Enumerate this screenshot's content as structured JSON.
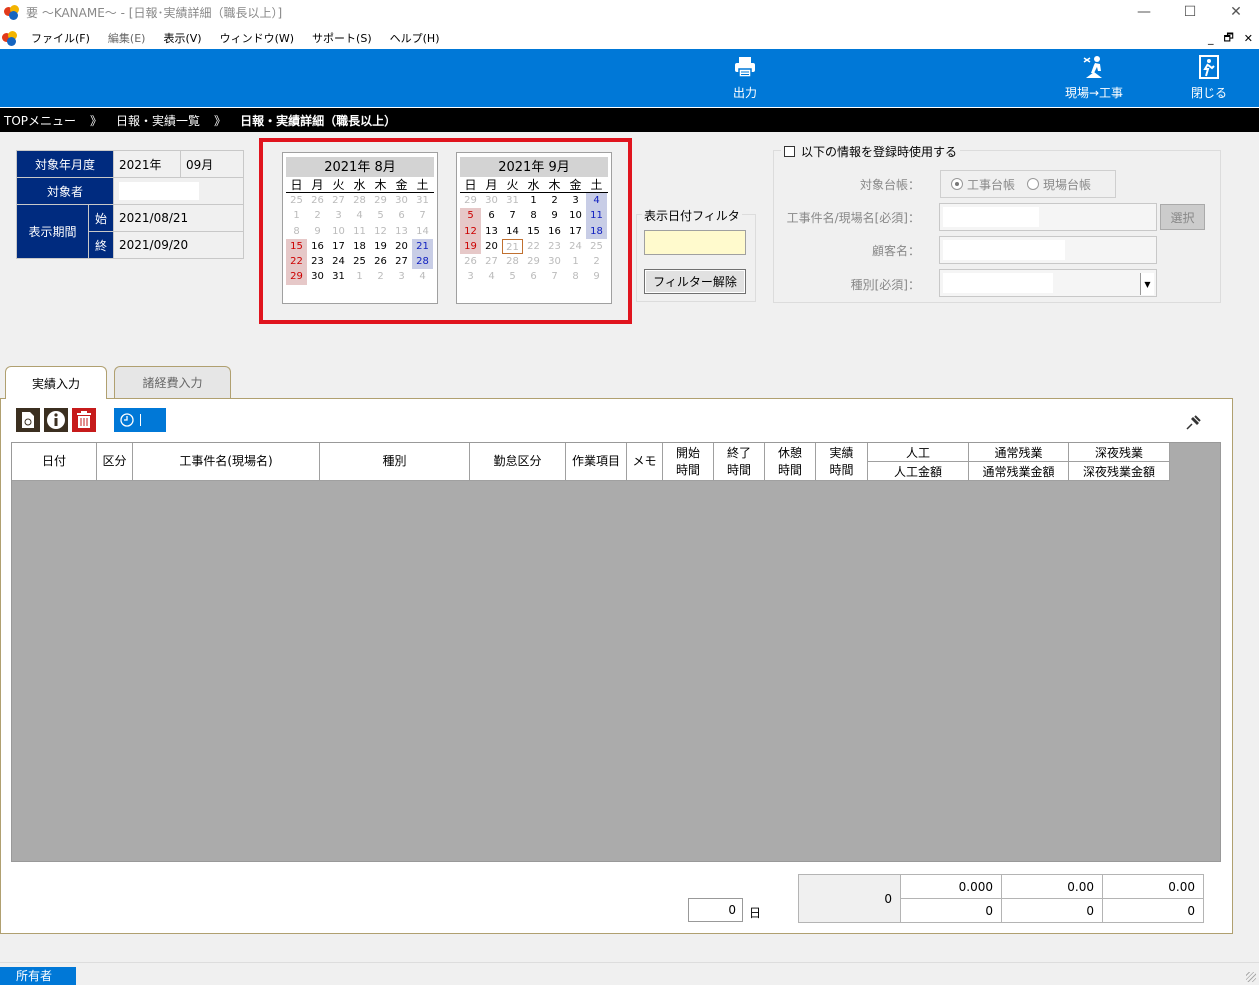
{
  "window": {
    "title": "要 〜KANAME〜 - [日報･実績詳細（職長以上）]",
    "minimize": "—",
    "maximize": "☐",
    "close": "✕"
  },
  "menu": {
    "items": [
      "ファイル(F)",
      "編集(E)",
      "表示(V)",
      "ウィンドウ(W)",
      "サポート(S)",
      "ヘルプ(H)"
    ],
    "mdi_minimize": "_",
    "mdi_restore": "🗗",
    "mdi_close": "✕"
  },
  "toolbar": {
    "print_label": "出力",
    "site_work_label": "現場→工事",
    "close_label": "閉じる"
  },
  "breadcrumb": {
    "items": [
      "TOPメニュー",
      "日報・実績一覧",
      "日報・実績詳細（職長以上）"
    ],
    "separator": "》"
  },
  "info": {
    "year_month_label": "対象年月度",
    "year_value": "2021年",
    "month_value": "09月",
    "person_label": "対象者",
    "period_label": "表示期間",
    "start_label": "始",
    "start_value": "2021/08/21",
    "end_label": "終",
    "end_value": "2021/09/20"
  },
  "calendars": [
    {
      "year": "2021年",
      "month": "8月",
      "weekdays": [
        "日",
        "月",
        "火",
        "水",
        "木",
        "金",
        "土"
      ],
      "days": [
        "25",
        "26",
        "27",
        "28",
        "29",
        "30",
        "31",
        "1",
        "2",
        "3",
        "4",
        "5",
        "6",
        "7",
        "8",
        "9",
        "10",
        "11",
        "12",
        "13",
        "14",
        "15",
        "16",
        "17",
        "18",
        "19",
        "20",
        "21",
        "22",
        "23",
        "24",
        "25",
        "26",
        "27",
        "28",
        "29",
        "30",
        "31",
        "1",
        "2",
        "3",
        "4"
      ]
    },
    {
      "year": "2021年",
      "month": "9月",
      "weekdays": [
        "日",
        "月",
        "火",
        "水",
        "木",
        "金",
        "土"
      ],
      "days": [
        "29",
        "30",
        "31",
        "1",
        "2",
        "3",
        "4",
        "5",
        "6",
        "7",
        "8",
        "9",
        "10",
        "11",
        "12",
        "13",
        "14",
        "15",
        "16",
        "17",
        "18",
        "19",
        "20",
        "21",
        "22",
        "23",
        "24",
        "25",
        "26",
        "27",
        "28",
        "29",
        "30",
        "1",
        "2",
        "3",
        "4",
        "5",
        "6",
        "7",
        "8",
        "9"
      ]
    }
  ],
  "filter": {
    "title": "表示日付フィルタ",
    "value": "",
    "clear_label": "フィルター解除"
  },
  "register": {
    "checkbox_label": "以下の情報を登録時使用する",
    "ledger_label": "対象台帳：",
    "radio_construction": "工事台帳",
    "radio_site": "現場台帳",
    "work_name_label": "工事件名/現場名[必須]：",
    "select_label": "選択",
    "customer_label": "顧客名：",
    "type_label": "種別[必須]："
  },
  "tabs": {
    "actual": "実績入力",
    "expenses": "諸経費入力"
  },
  "grid": {
    "columns": [
      "日付",
      "区分",
      "工事件名(現場名)",
      "種別",
      "勤怠区分",
      "作業項目",
      "メモ"
    ],
    "time_cols": [
      [
        "開始",
        "時間"
      ],
      [
        "終了",
        "時間"
      ],
      [
        "休憩",
        "時間"
      ],
      [
        "実績",
        "時間"
      ]
    ],
    "split_cols": [
      [
        "人工",
        "人工金額"
      ],
      [
        "通常残業",
        "通常残業金額"
      ],
      [
        "深夜残業",
        "深夜残業金額"
      ]
    ]
  },
  "summary": {
    "days_value": "0",
    "days_unit": "日",
    "total": "0",
    "row1": [
      "0.000",
      "0.00",
      "0.00"
    ],
    "row2": [
      "0",
      "0",
      "0"
    ]
  },
  "status": {
    "owner": "所有者"
  },
  "colors": {
    "accent": "#0078d7",
    "header_navy": "#002b7f",
    "highlight_red": "#e0141e"
  }
}
